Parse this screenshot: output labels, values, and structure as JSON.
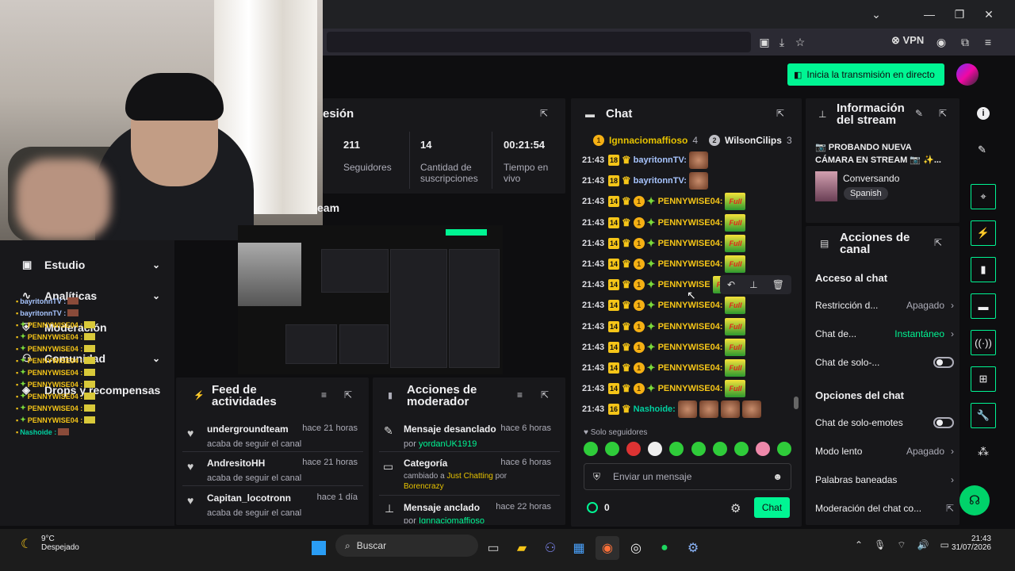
{
  "browser": {
    "vpn_label": "VPN"
  },
  "header": {
    "go_live_label": "Inicia la transmisión en directo"
  },
  "nav": {
    "items": [
      {
        "label": "Estudio"
      },
      {
        "label": "Analíticas"
      },
      {
        "label": "Comunidad"
      },
      {
        "label": "Moderación"
      },
      {
        "label": "Drops y recompensas"
      }
    ]
  },
  "minichat": {
    "lines": [
      "bayritonnTV :",
      "bayritonnTV :",
      "PENNYWISE04 :",
      "PENNYWISE04 :",
      "PENNYWISE04 :",
      "PENNYWISE04 :",
      "PENNYWISE04 :",
      "PENNYWISE04 :",
      "PENNYWISE04 :",
      "PENNYWISE04 :",
      "PENNYWISE04 :",
      "Nashoide :"
    ]
  },
  "session": {
    "title": "esión",
    "stats": [
      {
        "value": "211",
        "label": "Seguidores"
      },
      {
        "value": "14",
        "label": "Cantidad de suscripciones"
      },
      {
        "value": "00:21:54",
        "label": "Tiempo en vivo"
      }
    ]
  },
  "preview": {
    "title": "eam"
  },
  "activity": {
    "title": "Feed de actividades",
    "items": [
      {
        "name": "undergroundteam",
        "action": "acaba de seguir el canal",
        "time": "hace 21 horas"
      },
      {
        "name": "AndresitoHH",
        "action": "acaba de seguir el canal",
        "time": "hace 21 horas"
      },
      {
        "name": "Capitan_locotronn",
        "action": "acaba de seguir el canal",
        "time": "hace 1 día"
      }
    ]
  },
  "modactions": {
    "title": "Acciones de moderador",
    "items": [
      {
        "name": "Mensaje desanclado",
        "time": "hace 6 horas",
        "by_prefix": "por ",
        "by": "yordanUK1919"
      },
      {
        "name": "Categoría",
        "time": "hace 6 horas",
        "detail_prefix": "cambiado a ",
        "detail": "Just Chatting",
        "by_prefix": " por ",
        "by": "Borencrazy"
      },
      {
        "name": "Mensaje anclado",
        "time": "hace 22 horas",
        "by_prefix": "por ",
        "by": "Ignnaciomaffioso"
      }
    ]
  },
  "chat": {
    "title": "Chat",
    "top_gifters": [
      {
        "rank": "1",
        "name": "Ignnaciomaffioso",
        "count": "4"
      },
      {
        "rank": "2",
        "name": "WilsonCilips",
        "count": "3"
      }
    ],
    "messages": [
      {
        "time": "21:43",
        "badge": "18",
        "user": "bayritonnTV:",
        "coin": false,
        "spark": false,
        "color": "#a8c5ff"
      },
      {
        "time": "21:43",
        "badge": "18",
        "user": "bayritonnTV:",
        "coin": false,
        "spark": false,
        "color": "#a8c5ff"
      },
      {
        "time": "21:43",
        "badge": "14",
        "user": "PENNYWISE04:",
        "coin": true,
        "spark": true,
        "color": "#f5c518"
      },
      {
        "time": "21:43",
        "badge": "14",
        "user": "PENNYWISE04:",
        "coin": true,
        "spark": true,
        "color": "#f5c518"
      },
      {
        "time": "21:43",
        "badge": "14",
        "user": "PENNYWISE04:",
        "coin": true,
        "spark": true,
        "color": "#f5c518"
      },
      {
        "time": "21:43",
        "badge": "14",
        "user": "PENNYWISE04:",
        "coin": true,
        "spark": true,
        "color": "#f5c518"
      },
      {
        "time": "21:43",
        "badge": "14",
        "user": "PENNYWISE",
        "coin": true,
        "spark": true,
        "color": "#f5c518"
      },
      {
        "time": "21:43",
        "badge": "14",
        "user": "PENNYWISE04:",
        "coin": true,
        "spark": true,
        "color": "#f5c518"
      },
      {
        "time": "21:43",
        "badge": "14",
        "user": "PENNYWISE04:",
        "coin": true,
        "spark": true,
        "color": "#f5c518"
      },
      {
        "time": "21:43",
        "badge": "14",
        "user": "PENNYWISE04:",
        "coin": true,
        "spark": true,
        "color": "#f5c518"
      },
      {
        "time": "21:43",
        "badge": "14",
        "user": "PENNYWISE04:",
        "coin": true,
        "spark": true,
        "color": "#f5c518"
      },
      {
        "time": "21:43",
        "badge": "14",
        "user": "PENNYWISE04:",
        "coin": true,
        "spark": true,
        "color": "#f5c518"
      },
      {
        "time": "21:43",
        "badge": "16",
        "user": "Nashoide:",
        "coin": false,
        "spark": false,
        "color": "#00d0a0"
      }
    ],
    "emote_label": "Full",
    "followers_only": "Solo seguidores",
    "input_placeholder": "Enviar un mensaje",
    "points": "0",
    "send_label": "Chat"
  },
  "streaminfo": {
    "title": "Información del stream",
    "stream_title": "📷 PROBANDO NUEVA CÁMARA EN STREAM 📷 ✨...",
    "category": "Conversando",
    "tag": "Spanish"
  },
  "channel_actions": {
    "title": "Acciones de canal",
    "chat_access_heading": "Acceso al chat",
    "rows1": [
      {
        "label": "Restricción d...",
        "value": "Apagado",
        "type": "select"
      },
      {
        "label": "Chat de...",
        "value": "Instantáneo",
        "type": "select-green"
      },
      {
        "label": "Chat de solo-...",
        "value": "",
        "type": "toggle"
      }
    ],
    "chat_options_heading": "Opciones del chat",
    "rows2": [
      {
        "label": "Chat de solo-emotes",
        "value": "",
        "type": "toggle"
      },
      {
        "label": "Modo lento",
        "value": "Apagado",
        "type": "select"
      },
      {
        "label": "Palabras baneadas",
        "value": "",
        "type": "arrow"
      },
      {
        "label": "Moderación del chat co...",
        "value": "",
        "type": "external"
      }
    ]
  },
  "taskbar": {
    "temp": "9°C",
    "weather": "Despejado",
    "search": "Buscar",
    "time": "21:43",
    "date": "31/07/2026"
  },
  "colors": {
    "accent": "#00f593",
    "panel": "#18181b",
    "bg": "#0e0e10"
  }
}
